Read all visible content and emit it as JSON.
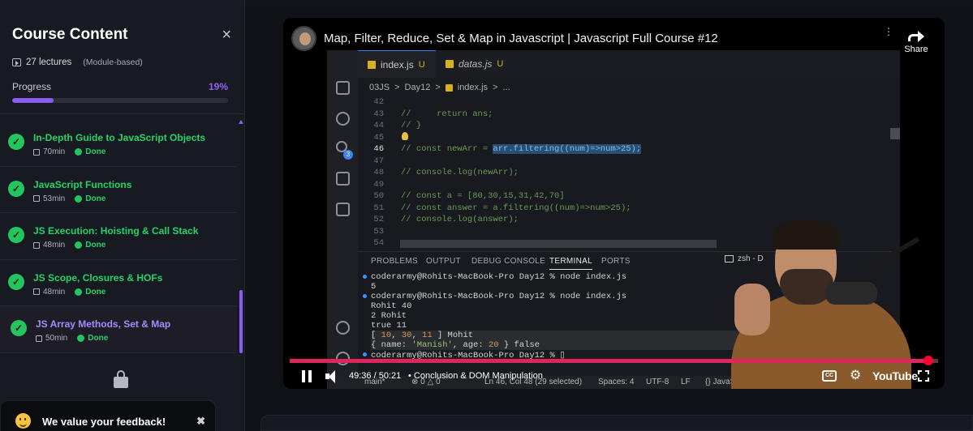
{
  "sidebar": {
    "title": "Course Content",
    "close_label": "×",
    "lectures": "27 lectures",
    "module": "(Module-based)",
    "progress_label": "Progress",
    "progress_pct": "19%",
    "progress_value": 0.19,
    "lessons": [
      {
        "title": "In-Depth Guide to JavaScript Objects",
        "duration": "70min",
        "status": "Done"
      },
      {
        "title": "JavaScript Functions",
        "duration": "53min",
        "status": "Done"
      },
      {
        "title": "JS Execution: Hoisting & Call Stack",
        "duration": "48min",
        "status": "Done"
      },
      {
        "title": "JS Scope, Closures & HOFs",
        "duration": "48min",
        "status": "Done"
      },
      {
        "title": "JS Array Methods, Set & Map",
        "duration": "50min",
        "status": "Done"
      }
    ],
    "feedback": "We value your feedback!",
    "feedback_close": "✖"
  },
  "video": {
    "title": "Map, Filter, Reduce, Set & Map in Javascript | Javascript Full Course #12",
    "share_label": "Share",
    "time": "49:36 / 50:21",
    "chapter": "• Conclusion & DOM Manipulation",
    "progress_value": 0.985,
    "brand": "YouTube",
    "cc_label": "CC"
  },
  "editor": {
    "tabs": [
      {
        "name": "index.js",
        "mark": "U"
      },
      {
        "name": "datas.js",
        "mark": "U"
      }
    ],
    "breadcrumb": [
      "03JS",
      ">",
      "Day12",
      ">",
      "index.js",
      ">",
      "..."
    ],
    "lines": [
      {
        "n": "42",
        "code": ""
      },
      {
        "n": "43",
        "code": "//     return ans;"
      },
      {
        "n": "44",
        "code": "// }"
      },
      {
        "n": "45",
        "code": ""
      },
      {
        "n": "46",
        "code_pre": "// const newArr = ",
        "code_sel": "arr.filtering((num)=>num>25);",
        "current": true
      },
      {
        "n": "47",
        "code": ""
      },
      {
        "n": "48",
        "code": "// console.log(newArr);"
      },
      {
        "n": "49",
        "code": ""
      },
      {
        "n": "50",
        "code": "// const a = [80,30,15,31,42,70]"
      },
      {
        "n": "51",
        "code": "// const answer = a.filtering((num)=>num>25);"
      },
      {
        "n": "52",
        "code": "// console.log(answer);"
      },
      {
        "n": "53",
        "code": ""
      },
      {
        "n": "54",
        "code": ""
      }
    ],
    "panel_tabs": [
      "PROBLEMS",
      "OUTPUT",
      "DEBUG CONSOLE",
      "TERMINAL",
      "PORTS"
    ],
    "active_panel": "TERMINAL",
    "terminal_name": "zsh - D",
    "terminal": {
      "l1": "coderarmy@Rohits-MacBook-Pro Day12 % node index.js",
      "l2": "5",
      "l3": "coderarmy@Rohits-MacBook-Pro Day12 % node index.js",
      "l4": "Rohit 40",
      "l5": "2 Rohit",
      "l6": "true 11",
      "l7a": "[ ",
      "l7b": "10",
      "l7c": ", ",
      "l7d": "30",
      "l7e": ", ",
      "l7f": "11",
      "l7g": " ] Mohit",
      "l8a": "{ name: ",
      "l8b": "'Manish'",
      "l8c": ", age: ",
      "l8d": "20",
      "l8e": " } false",
      "l9": "coderarmy@Rohits-MacBook-Pro Day12 % ▯"
    },
    "status": {
      "branch": "main*",
      "errors": "⊗ 0 △ 0",
      "position": "Ln 46, Col 48 (29 selected)",
      "spaces": "Spaces: 4",
      "encoding": "UTF-8",
      "eol": "LF",
      "lang": "{} JavaS"
    },
    "scm_badge": "3"
  }
}
